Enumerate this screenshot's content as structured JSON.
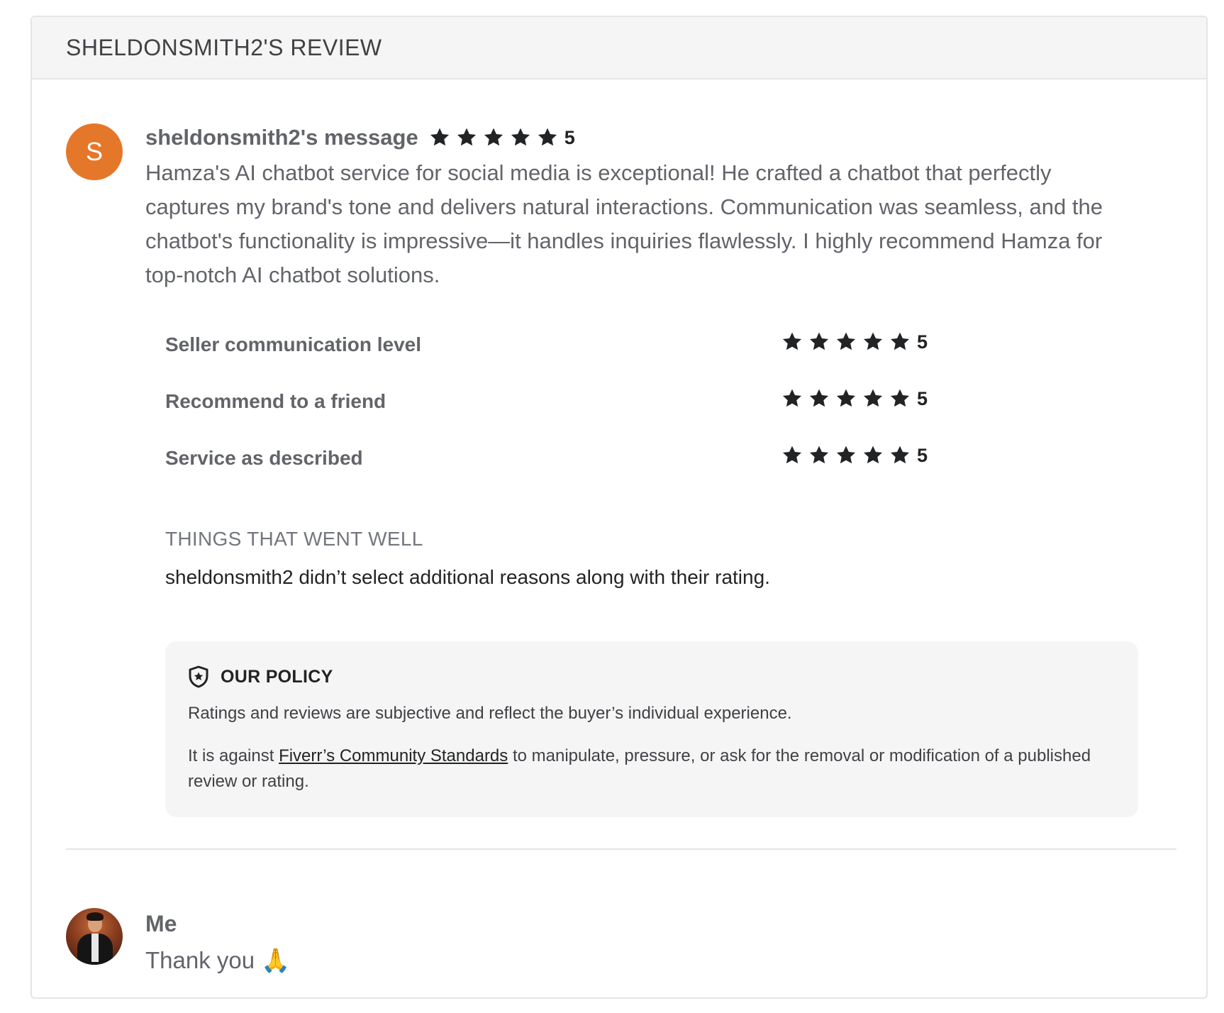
{
  "header": {
    "title": "SHELDONSMITH2'S REVIEW"
  },
  "review": {
    "avatar_letter": "S",
    "avatar_color": "#e5772a",
    "author_label": "sheldonsmith2's message",
    "rating": "5",
    "rating_stars": 5,
    "text": "Hamza's AI chatbot service for social media is exceptional! He crafted a chatbot that perfectly captures my brand's tone and delivers natural interactions. Communication was seamless, and the chatbot's functionality is impressive—it handles inquiries flawlessly. I highly recommend Hamza for top-notch AI chatbot solutions."
  },
  "ratings": [
    {
      "label": "Seller communication level",
      "value": "5",
      "stars": 5
    },
    {
      "label": "Recommend to a friend",
      "value": "5",
      "stars": 5
    },
    {
      "label": "Service as described",
      "value": "5",
      "stars": 5
    }
  ],
  "went_well": {
    "title": "THINGS THAT WENT WELL",
    "text": "sheldonsmith2 didn’t select additional reasons along with their rating."
  },
  "policy": {
    "title": "OUR POLICY",
    "p1": "Ratings and reviews are subjective and reflect the buyer’s individual experience.",
    "p2_before": "It is against ",
    "p2_link": "Fiverr’s Community Standards",
    "p2_after": " to manipulate, pressure, or ask for the removal or modification of a published review or rating."
  },
  "reply": {
    "name": "Me",
    "text": "Thank you 🙏"
  },
  "icons": {
    "star": "star-icon",
    "shield": "shield-star-icon"
  }
}
